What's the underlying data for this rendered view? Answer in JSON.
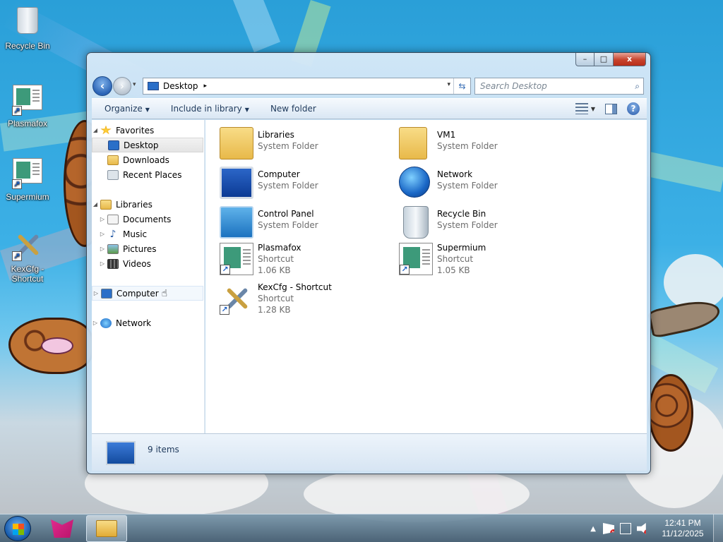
{
  "desktop": {
    "icons": [
      {
        "label": "Recycle Bin",
        "icon": "recycle-bin-icon"
      },
      {
        "label": "Plasmafox",
        "icon": "plasmafox-app-icon"
      },
      {
        "label": "Supermium",
        "icon": "supermium-app-icon"
      },
      {
        "label": "KexCfg - Shortcut",
        "icon": "kexcfg-tools-icon"
      }
    ]
  },
  "window": {
    "controls": {
      "minimize": "–",
      "maximize": "□",
      "close": "x"
    },
    "address": {
      "crumb": "Desktop",
      "separator": "▸"
    },
    "search": {
      "placeholder": "Search Desktop"
    },
    "toolbar": {
      "organize": "Organize",
      "include_in_library": "Include in library",
      "new_folder": "New folder"
    },
    "nav_pane": {
      "favorites": {
        "label": "Favorites",
        "items": [
          "Desktop",
          "Downloads",
          "Recent Places"
        ]
      },
      "libraries": {
        "label": "Libraries",
        "items": [
          "Documents",
          "Music",
          "Pictures",
          "Videos"
        ]
      },
      "computer": "Computer",
      "network": "Network"
    },
    "content": {
      "items": [
        {
          "name": "Libraries",
          "type": "System Folder",
          "size": "",
          "icon": "libraries-folder-icon"
        },
        {
          "name": "VM1",
          "type": "System Folder",
          "size": "",
          "icon": "user-folder-icon"
        },
        {
          "name": "Computer",
          "type": "System Folder",
          "size": "",
          "icon": "computer-icon"
        },
        {
          "name": "Network",
          "type": "System Folder",
          "size": "",
          "icon": "network-globe-icon"
        },
        {
          "name": "Control Panel",
          "type": "System Folder",
          "size": "",
          "icon": "control-panel-icon"
        },
        {
          "name": "Recycle Bin",
          "type": "System Folder",
          "size": "",
          "icon": "recycle-bin-icon"
        },
        {
          "name": "Plasmafox",
          "type": "Shortcut",
          "size": "1.06 KB",
          "icon": "plasmafox-shortcut-icon"
        },
        {
          "name": "Supermium",
          "type": "Shortcut",
          "size": "1.05 KB",
          "icon": "supermium-shortcut-icon"
        },
        {
          "name": "KexCfg - Shortcut",
          "type": "Shortcut",
          "size": "1.28 KB",
          "icon": "kexcfg-shortcut-icon"
        }
      ]
    },
    "details": {
      "count": "9 items"
    }
  },
  "taskbar": {
    "clock": {
      "time": "12:41 PM",
      "date": "11/12/2025"
    },
    "tray_up": "▲"
  },
  "colors": {
    "accent": "#2b64b6",
    "close": "#c7432c",
    "folder": "#e8b94a"
  }
}
